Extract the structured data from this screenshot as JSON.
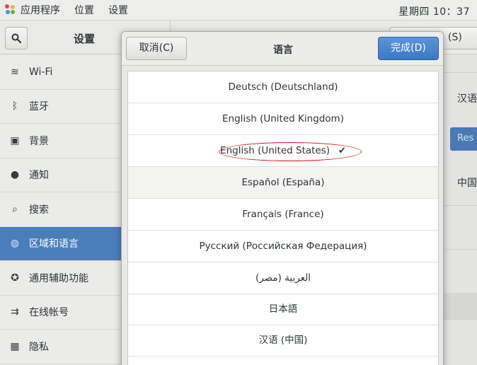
{
  "topbar": {
    "menu": [
      "应用程序",
      "位置",
      "设置"
    ],
    "clock": "星期四 10：37"
  },
  "header": {
    "title": "设置",
    "right_button_partial": "(S)"
  },
  "sidebar": {
    "items": [
      {
        "label": "Wi-Fi",
        "icon": "wifi-icon",
        "glyph": "≋"
      },
      {
        "label": "蓝牙",
        "icon": "bluetooth-icon",
        "glyph": "ᛒ"
      },
      {
        "label": "背景",
        "icon": "background-icon",
        "glyph": "▣"
      },
      {
        "label": "通知",
        "icon": "notification-icon",
        "glyph": "●"
      },
      {
        "label": "搜索",
        "icon": "search-icon",
        "glyph": "⌕"
      },
      {
        "label": "区域和语言",
        "icon": "region-icon",
        "glyph": "◍",
        "active": true
      },
      {
        "label": "通用辅助功能",
        "icon": "accessibility-icon",
        "glyph": "✪"
      },
      {
        "label": "在线帐号",
        "icon": "online-accounts-icon",
        "glyph": "⇉"
      },
      {
        "label": "隐私",
        "icon": "privacy-icon",
        "glyph": "▦"
      }
    ]
  },
  "content": {
    "language_partial": "汉语",
    "button_partial": "Res",
    "format_partial": "中国"
  },
  "dialog": {
    "title": "语言",
    "cancel_label": "取消(C)",
    "done_label": "完成(D)",
    "languages": [
      {
        "label": "Deutsch (Deutschland)"
      },
      {
        "label": "English (United Kingdom)"
      },
      {
        "label": "English (United States)",
        "selected": true
      },
      {
        "label": "Español (España)",
        "hover": true
      },
      {
        "label": "Français (France)"
      },
      {
        "label": "Русский (Российская Федерация)"
      },
      {
        "label": "العربية (مصر)"
      },
      {
        "label": "日本語"
      },
      {
        "label": "汉语 (中国)"
      }
    ],
    "check_glyph": "✔"
  },
  "colors": {
    "accent": "#4a7ebb",
    "done_button": "#3a78c7",
    "annotation_circle": "#d2212b"
  }
}
